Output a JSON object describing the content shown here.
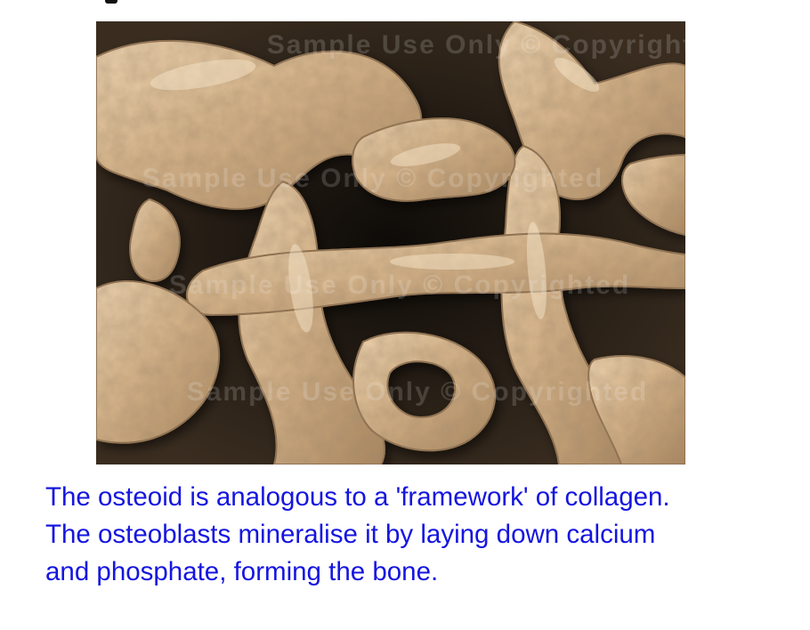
{
  "image": {
    "subject": "bone-trabecular-structure",
    "watermark_lines": [
      "Sample Use Only © Copyrighted",
      "Sample Use Only © Copyrighted",
      "Sample Use Only © Copyrighted",
      "Sample Use Only © Copyrighted"
    ]
  },
  "caption": {
    "line1": "The osteoid is analogous to a 'framework' of collagen.",
    "line2": "The osteoblasts mineralise it by laying down calcium",
    "line3": "and phosphate, forming the bone."
  },
  "colors": {
    "caption_text": "#1515e0",
    "bone_light": "#e6c9a2",
    "bone_mid": "#c9a57a",
    "bone_shadow": "#8a6a48",
    "cavity": "#1e1812"
  }
}
